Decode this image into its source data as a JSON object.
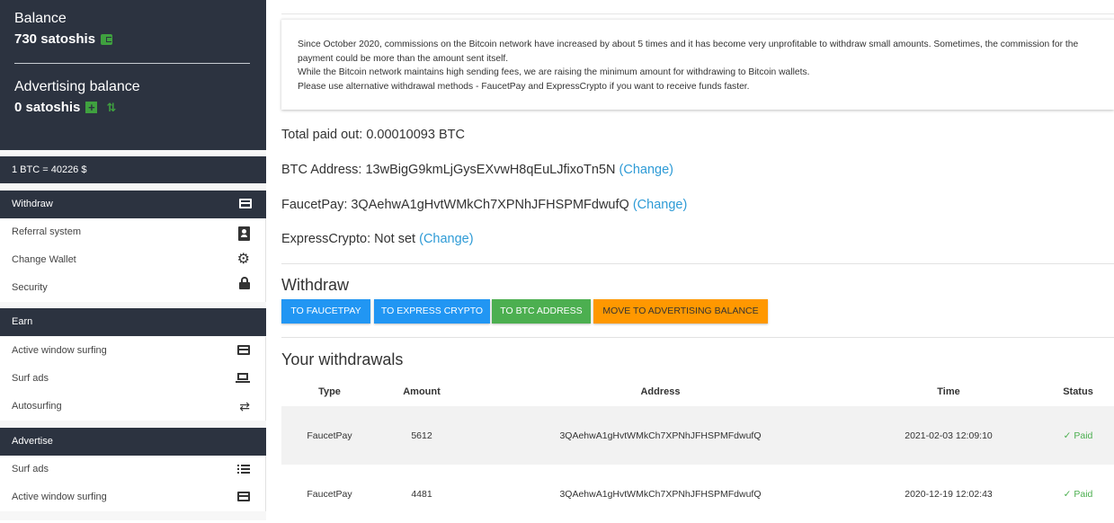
{
  "balance": {
    "label": "Balance",
    "value": "730 satoshis",
    "adv_label": "Advertising balance",
    "adv_value": "0 satoshis"
  },
  "rate": "1 BTC = 40226 $",
  "sections": {
    "withdraw": {
      "title": "Withdraw",
      "items": [
        {
          "label": "Referral system",
          "icon": "contact-card-icon"
        },
        {
          "label": "Change Wallet",
          "icon": "gear-icon"
        },
        {
          "label": "Security",
          "icon": "lock-icon"
        }
      ]
    },
    "earn": {
      "title": "Earn",
      "items": [
        {
          "label": "Active window surfing",
          "icon": "browser-window-icon"
        },
        {
          "label": "Surf ads",
          "icon": "laptop-icon"
        },
        {
          "label": "Autosurfing",
          "icon": "repeat-icon"
        }
      ]
    },
    "advertise": {
      "title": "Advertise",
      "items": [
        {
          "label": "Surf ads",
          "icon": "list-icon"
        },
        {
          "label": "Active window surfing",
          "icon": "browser-window-icon"
        }
      ]
    }
  },
  "notice": {
    "line1": "Since October 2020, commissions on the Bitcoin network have increased by about 5 times and it has become very unprofitable to withdraw small amounts. Sometimes, the commission for the payment could be more than the amount sent itself.",
    "line2": "While the Bitcoin network maintains high sending fees, we are raising the minimum amount for withdrawing to Bitcoin wallets.",
    "line3": "Please use alternative withdrawal methods - FaucetPay and ExpressCrypto if you want to receive funds faster."
  },
  "info": {
    "total_paid": "Total paid out: 0.00010093 BTC",
    "btc_address_label": "BTC Address: 13wBigG9kmLjGysEXvwH8qEuLJfixoTn5N",
    "faucetpay_label": "FaucetPay: 3QAehwA1gHvtWMkCh7XPNhJFHSPMFdwufQ",
    "expresscrypto_label": "ExpressCrypto: Not set",
    "change_link": "(Change)"
  },
  "withdraw": {
    "heading": "Withdraw",
    "buttons": {
      "faucetpay": "TO FAUCETPAY",
      "expresscrypto": "TO EXPRESS CRYPTO",
      "btc": "TO BTC ADDRESS",
      "advertising": "MOVE TO ADVERTISING BALANCE"
    },
    "colors": {
      "blue": "#2196f3",
      "green": "#4caf50",
      "orange": "#ff9800"
    }
  },
  "withdrawals": {
    "heading": "Your withdrawals",
    "columns": [
      "Type",
      "Amount",
      "Address",
      "Time",
      "Status"
    ],
    "rows": [
      [
        "FaucetPay",
        "5612",
        "3QAehwA1gHvtWMkCh7XPNhJFHSPMFdwufQ",
        "2021-02-03 12:09:10",
        "Paid"
      ],
      [
        "FaucetPay",
        "4481",
        "3QAehwA1gHvtWMkCh7XPNhJFHSPMFdwufQ",
        "2020-12-19 12:02:43",
        "Paid"
      ]
    ]
  }
}
